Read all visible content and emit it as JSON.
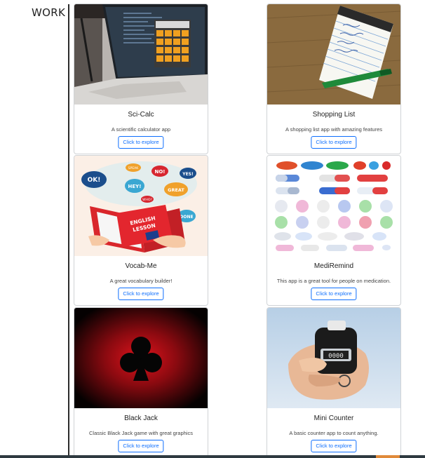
{
  "section": {
    "title": "WORK"
  },
  "projects": [
    {
      "title": "Sci-Calc",
      "description": "A scientific calculator app",
      "button": "Click to explore",
      "image": "laptop-calculator"
    },
    {
      "title": "Shopping List",
      "description": "A shopping list app with amazing features",
      "button": "Click to explore",
      "image": "notepad-pen"
    },
    {
      "title": "Vocab-Me",
      "description": "A great vocabulary builder!",
      "button": "Click to explore",
      "image": "english-lesson-book",
      "image_text": {
        "speech_ok": "OK!",
        "speech_hey": "HEY!",
        "speech_no": "NO!",
        "speech_yes": "YES!",
        "speech_great": "GREAT",
        "speech_done": "DONE",
        "speech_speak": "SPEAK",
        "speech_who": "WHO?",
        "book_line1": "ENGLISH",
        "book_line2": "LESSON"
      }
    },
    {
      "title": "MediRemind",
      "description": "This app is a great tool for people on medication.",
      "button": "Click to explore",
      "image": "pills"
    },
    {
      "title": "Black Jack",
      "description": "Classic Black Jack game with great graphics",
      "button": "Click to explore",
      "image": "club-suit"
    },
    {
      "title": "Mini Counter",
      "description": "A basic counter app to count anything.",
      "button": "Click to explore",
      "image": "hand-tally-counter",
      "image_text": {
        "counter_display": "0000"
      }
    }
  ],
  "colors": {
    "button_border": "#0d6efd",
    "button_text": "#0d6efd",
    "card_border": "#d0d3d6",
    "timeline": "#2b2b2b"
  }
}
